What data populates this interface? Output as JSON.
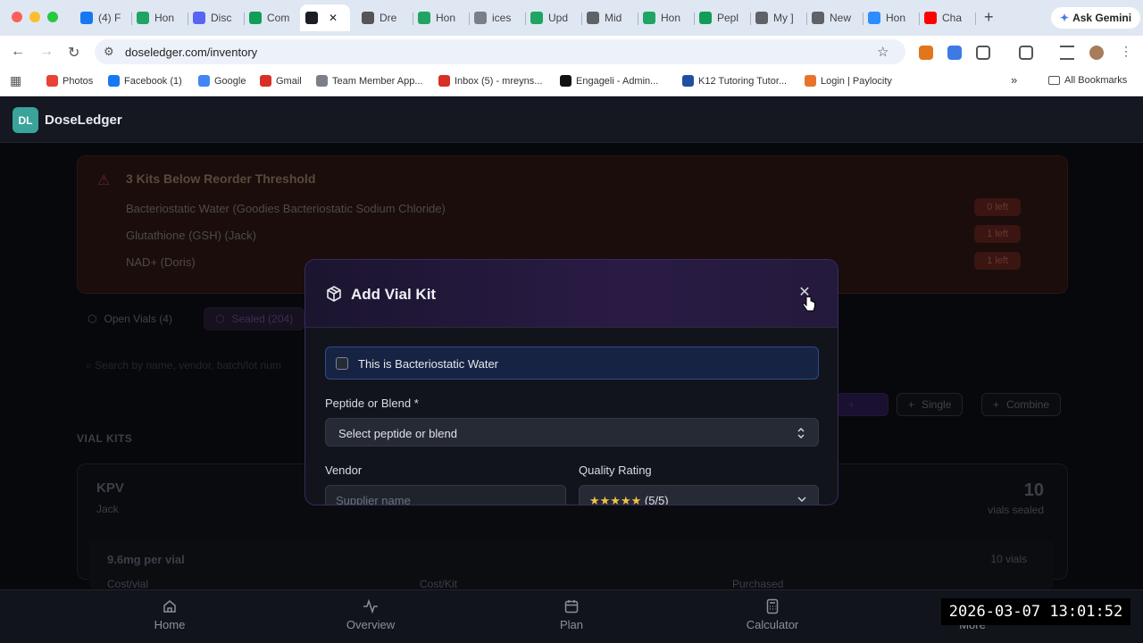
{
  "browser": {
    "tabs": [
      {
        "label": "(4) F",
        "color": "#1877f2"
      },
      {
        "label": "Hon",
        "color": "#1fa463"
      },
      {
        "label": "Disc",
        "color": "#5865f2"
      },
      {
        "label": "Com",
        "color": "#0f9d58"
      },
      {
        "label": "",
        "color": "#1b1d24",
        "active": true
      },
      {
        "label": "Dre",
        "color": "#555555"
      },
      {
        "label": "Hon",
        "color": "#1fa463"
      },
      {
        "label": "ices",
        "color": "#7a7f88"
      },
      {
        "label": "Upd",
        "color": "#1fa463"
      },
      {
        "label": "Mid",
        "color": "#5f6368"
      },
      {
        "label": "Hon",
        "color": "#1fa463"
      },
      {
        "label": "Pepl",
        "color": "#0f9d58"
      },
      {
        "label": "My ]",
        "color": "#5f6368"
      },
      {
        "label": "New",
        "color": "#5f6368"
      },
      {
        "label": "Hon",
        "color": "#2d8cff"
      },
      {
        "label": "Cha",
        "color": "#ff0000"
      }
    ],
    "ask_gemini": "Ask Gemini",
    "url": "doseledger.com/inventory",
    "bookmarks": [
      {
        "label": "Photos",
        "color": "#ea4335"
      },
      {
        "label": "Facebook (1)",
        "color": "#1877f2"
      },
      {
        "label": "Google",
        "color": "#4285f4"
      },
      {
        "label": "Gmail",
        "color": "#d93025"
      },
      {
        "label": "Team Member App...",
        "color": "#7a7f88"
      },
      {
        "label": "Inbox (5) - mreyns...",
        "color": "#d93025"
      },
      {
        "label": "Engageli - Admin...",
        "color": "#111111"
      },
      {
        "label": "K12 Tutoring Tutor...",
        "color": "#1e4fa3"
      },
      {
        "label": "Login | Paylocity",
        "color": "#e8742c"
      }
    ],
    "all_bookmarks": "All Bookmarks"
  },
  "app": {
    "logo": "DL",
    "name": "DoseLedger",
    "alert": {
      "title": "3 Kits Below Reorder Threshold",
      "items": [
        {
          "name": "Bacteriostatic Water (Goodies Bacteriostatic Sodium Chloride)",
          "badge": "0 left"
        },
        {
          "name": "Glutathione (GSH) (Jack)",
          "badge": "1 left"
        },
        {
          "name": "NAD+ (Doris)",
          "badge": "1 left"
        }
      ]
    },
    "tabs": {
      "open": "Open Vials (4)",
      "sealed": "Sealed (204)"
    },
    "search_placeholder": "Search by name, vendor, batch/lot num",
    "section_title": "VIAL KITS",
    "actions": {
      "single": "Single",
      "combine": "Combine"
    },
    "kit": {
      "name": "KPV",
      "owner": "Jack",
      "count": "10",
      "count_label": "vials sealed",
      "dose": "9.6mg per vial",
      "vials": "10 vials",
      "col1": "Cost/vial",
      "col2": "Cost/Kit",
      "col3": "Purchased"
    },
    "nav": [
      "Home",
      "Overview",
      "Plan",
      "Calculator",
      "More"
    ]
  },
  "modal": {
    "title": "Add Vial Kit",
    "bac_water_label": "This is Bacteriostatic Water",
    "peptide_label": "Peptide or Blend *",
    "peptide_placeholder": "Select peptide or blend",
    "vendor_label": "Vendor",
    "vendor_placeholder": "Supplier name",
    "quality_label": "Quality Rating",
    "quality_stars": "★★★★★",
    "quality_value": "(5/5)"
  },
  "timestamp": "2026-03-07  13:01:52"
}
